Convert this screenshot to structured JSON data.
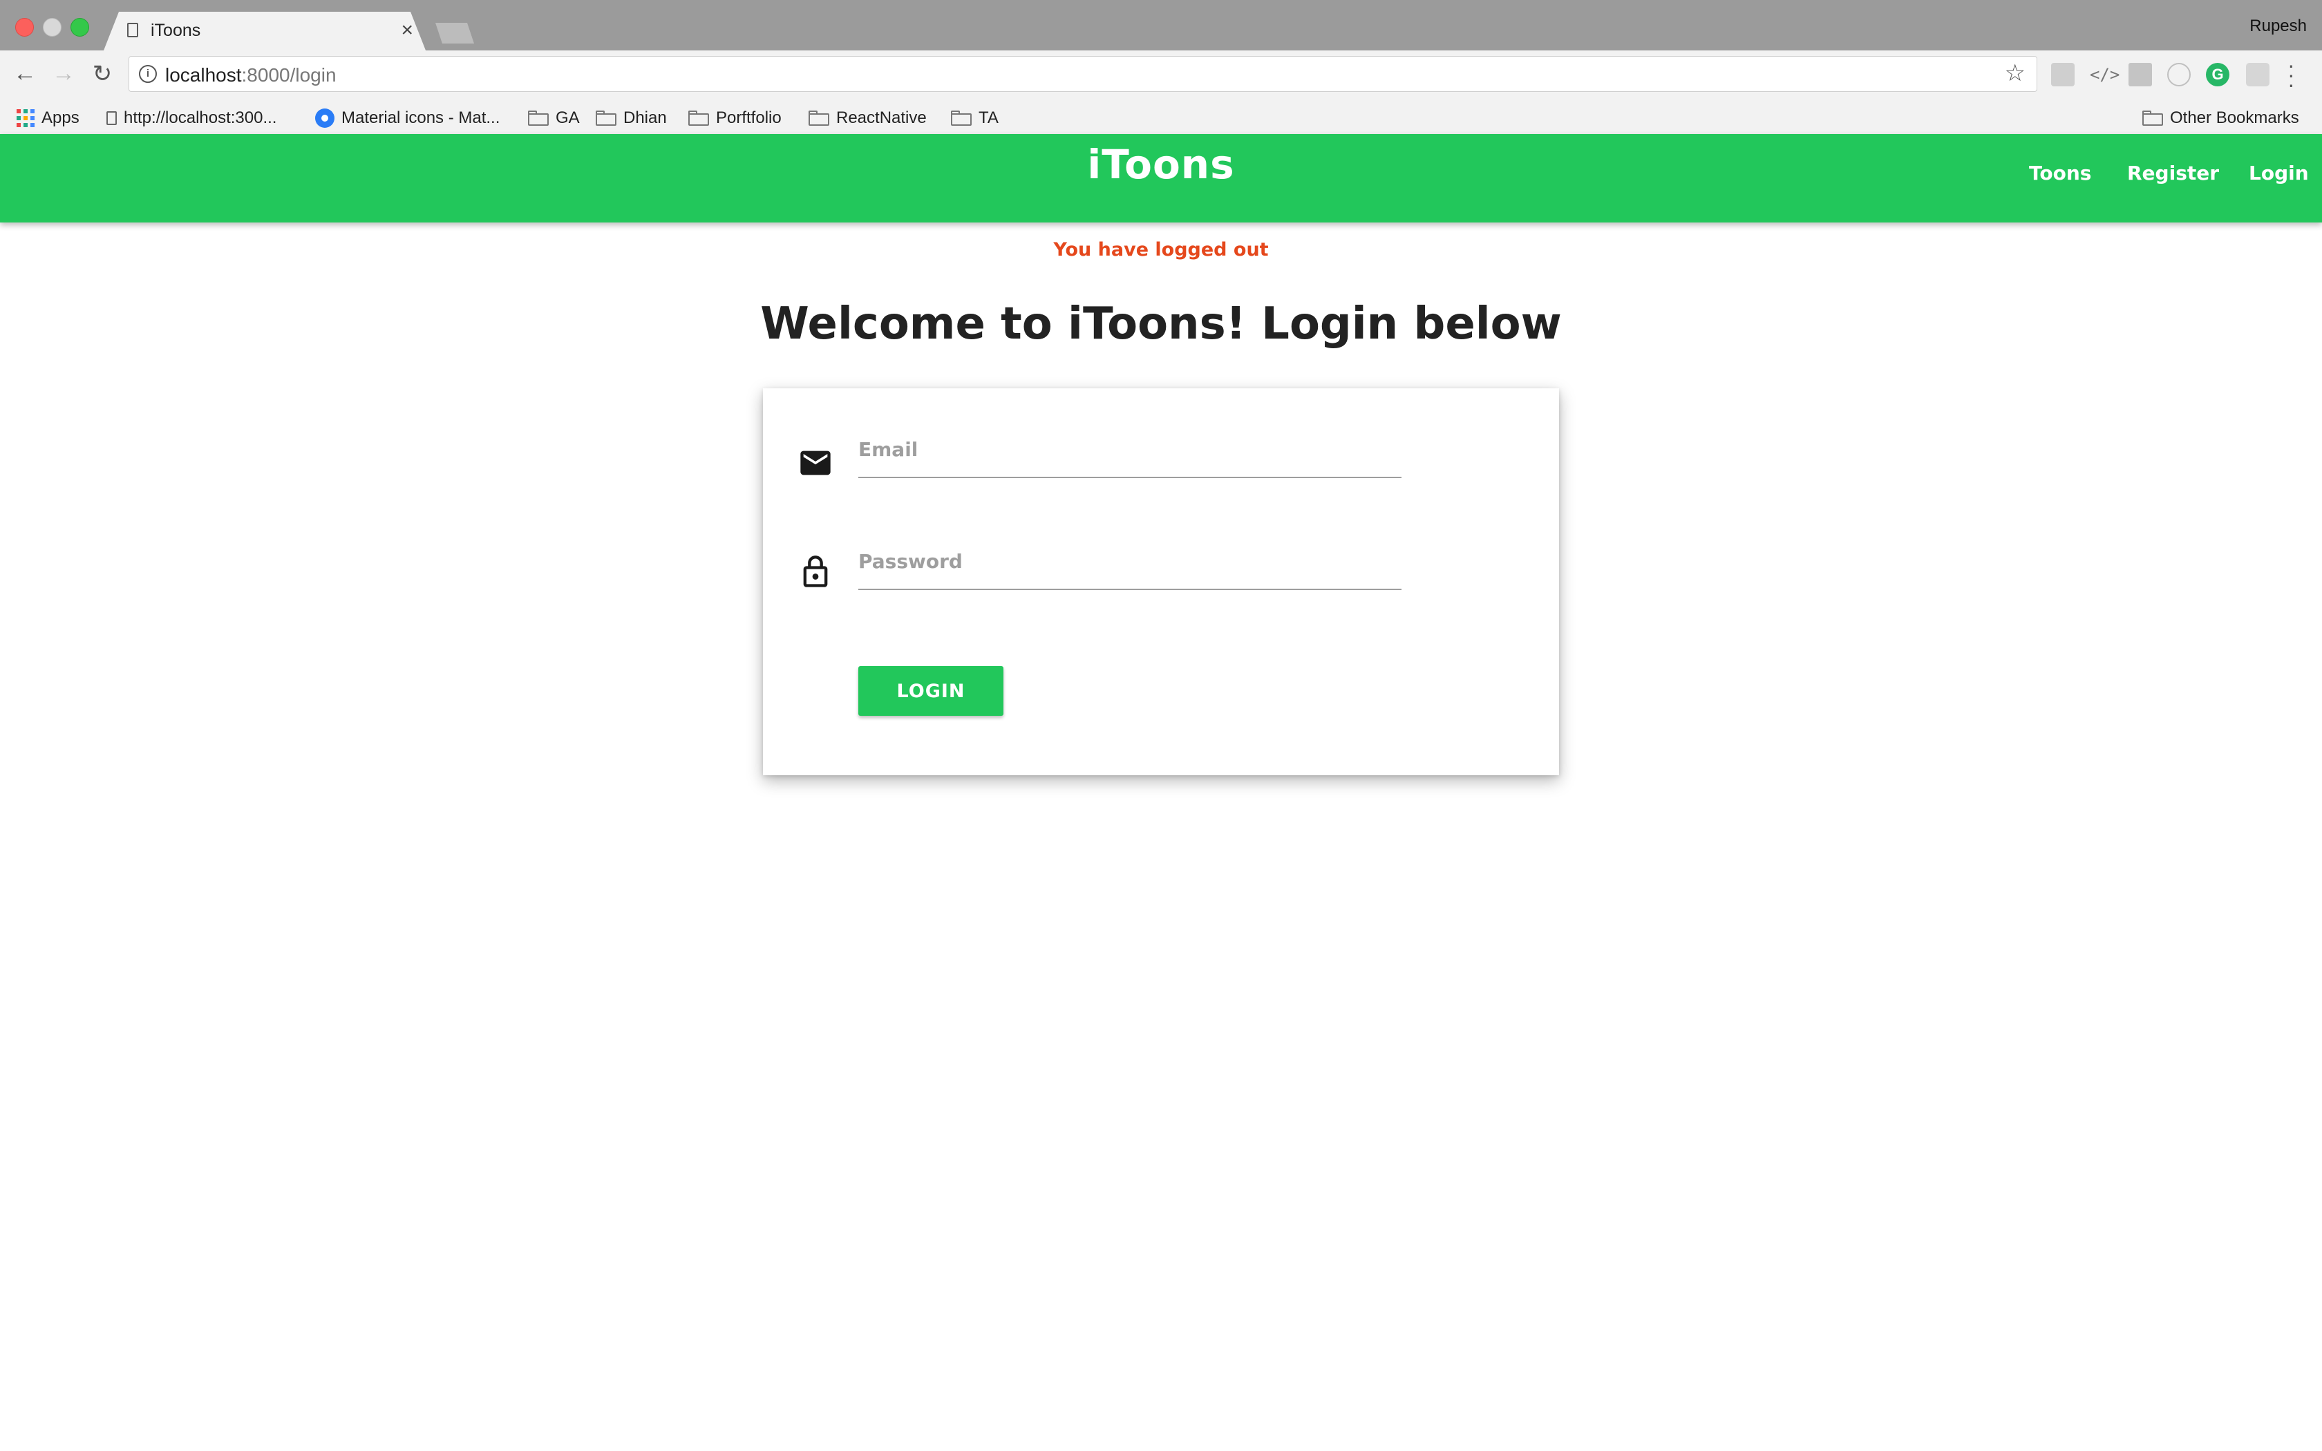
{
  "browser": {
    "tab_title": "iToons",
    "tab_close": "×",
    "profile_name": "Rupesh",
    "url_host": "localhost",
    "url_rest": ":8000/login",
    "bookmarks": [
      {
        "label": "Apps",
        "icon": "apps-grid-icon"
      },
      {
        "label": "http://localhost:300...",
        "icon": "page-icon"
      },
      {
        "label": "Material icons - Mat...",
        "icon": "material-icon"
      },
      {
        "label": "GA",
        "icon": "folder-icon"
      },
      {
        "label": "Dhian",
        "icon": "folder-icon"
      },
      {
        "label": "Porftfolio",
        "icon": "folder-icon"
      },
      {
        "label": "ReactNative",
        "icon": "folder-icon"
      },
      {
        "label": "TA",
        "icon": "folder-icon"
      }
    ],
    "other_bookmarks": "Other Bookmarks",
    "extension_g": "G"
  },
  "navbar": {
    "brand": "iToons",
    "links": [
      "Toons",
      "Register",
      "Login"
    ],
    "color": "#22c75b"
  },
  "main": {
    "flash": "You have logged out",
    "flash_color": "#e5481c",
    "heading": "Welcome to iToons! Login below",
    "form": {
      "email_placeholder": "Email",
      "email_value": "",
      "password_placeholder": "Password",
      "password_value": "",
      "submit_label": "LOGIN"
    }
  }
}
